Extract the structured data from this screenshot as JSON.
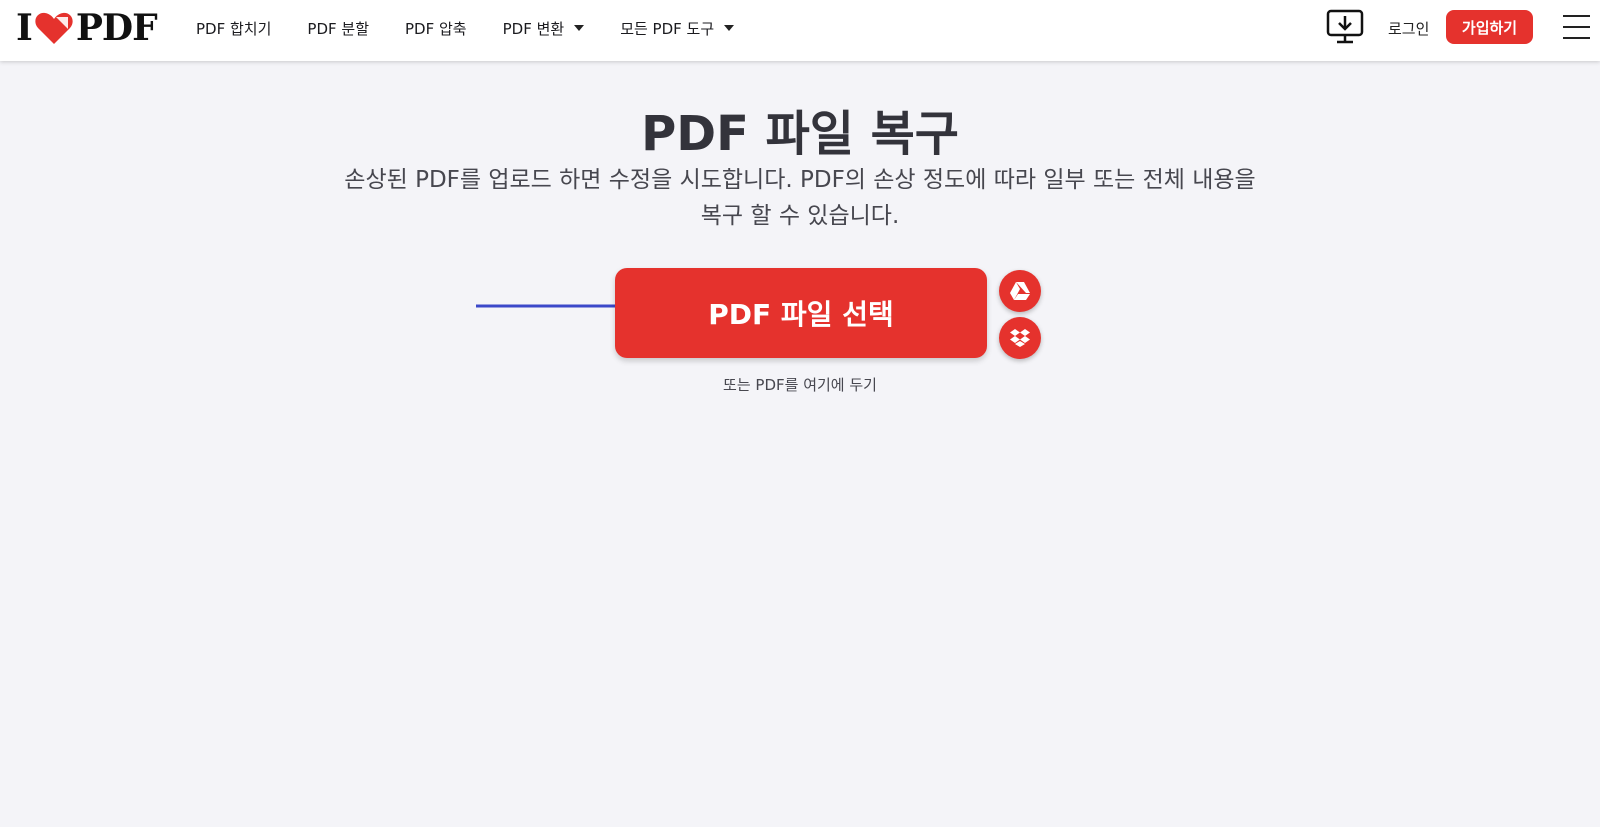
{
  "header": {
    "logo_left": "I",
    "logo_right": "PDF",
    "nav": [
      {
        "label": "PDF 합치기",
        "dropdown": false
      },
      {
        "label": "PDF 분할",
        "dropdown": false
      },
      {
        "label": "PDF 압축",
        "dropdown": false
      },
      {
        "label": "PDF 변환",
        "dropdown": true
      },
      {
        "label": "모든 PDF 도구",
        "dropdown": true
      }
    ],
    "login_label": "로그인",
    "signup_label": "가입하기"
  },
  "main": {
    "title": "PDF 파일 복구",
    "subtitle": "손상된 PDF를 업로드 하면 수정을 시도합니다. PDF의 손상 정도에 따라 일부 또는 전체 내용을 복구 할 수 있습니다.",
    "select_button_label": "PDF 파일 선택",
    "drop_hint": "또는 PDF를 여기에 두기"
  },
  "colors": {
    "accent": "#e5322d",
    "background": "#f4f4f8",
    "annotation_arrow": "#3b48c9"
  },
  "icons": {
    "desktop": "desktop-download-icon",
    "google_drive": "google-drive-icon",
    "dropbox": "dropbox-icon",
    "menu": "hamburger-menu-icon"
  }
}
